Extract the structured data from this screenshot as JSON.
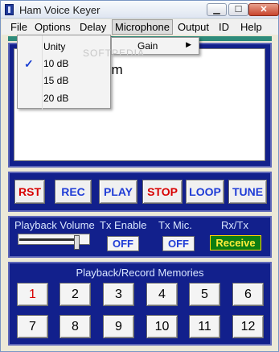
{
  "window": {
    "title": "Ham Voice Keyer",
    "controls": [
      "▁",
      "☐",
      "✕"
    ]
  },
  "menubar": {
    "items": [
      "File",
      "Options",
      "Delay",
      "Microphone",
      "Output",
      "ID",
      "Help"
    ],
    "open_index": 3
  },
  "microphone_menu": {
    "items": [
      {
        "label": "Unity",
        "checked": false
      },
      {
        "label": "10 dB",
        "checked": true
      },
      {
        "label": "15 dB",
        "checked": false
      },
      {
        "label": "20 dB",
        "checked": false
      }
    ],
    "checkmark": "✓",
    "submenu": {
      "label": "Gain",
      "arrow": "▶"
    }
  },
  "text_area": {
    "visible_text": "om",
    "watermark": "SOFTPEDIA"
  },
  "function_buttons": [
    {
      "label": "RST",
      "color": "#d80000"
    },
    {
      "label": "REC",
      "color": "#1f3cd6"
    },
    {
      "label": "PLAY",
      "color": "#1f3cd6"
    },
    {
      "label": "STOP",
      "color": "#d80000"
    },
    {
      "label": "LOOP",
      "color": "#1f3cd6"
    },
    {
      "label": "TUNE",
      "color": "#1f3cd6"
    }
  ],
  "controls_panel": {
    "playback_volume_label": "Playback Volume",
    "volume_level": 0.85,
    "tx_enable_label": "Tx Enable",
    "tx_enable_value": "OFF",
    "tx_mic_label": "Tx Mic.",
    "tx_mic_value": "OFF",
    "rxtx_label": "Rx/Tx",
    "rxtx_value": "Receive"
  },
  "memories": {
    "title": "Playback/Record Memories",
    "buttons": [
      {
        "label": "1",
        "color": "#d80000"
      },
      {
        "label": "2",
        "color": "#000000"
      },
      {
        "label": "3",
        "color": "#000000"
      },
      {
        "label": "4",
        "color": "#000000"
      },
      {
        "label": "5",
        "color": "#000000"
      },
      {
        "label": "6",
        "color": "#000000"
      },
      {
        "label": "7",
        "color": "#000000"
      },
      {
        "label": "8",
        "color": "#000000"
      },
      {
        "label": "9",
        "color": "#000000"
      },
      {
        "label": "10",
        "color": "#000000"
      },
      {
        "label": "11",
        "color": "#000000"
      },
      {
        "label": "12",
        "color": "#000000"
      }
    ]
  },
  "colors": {
    "panel_bg": "#12208c",
    "panel_label": "#d9e6ff",
    "receive_bg": "#0c7d12",
    "receive_text": "#ffee3a"
  }
}
